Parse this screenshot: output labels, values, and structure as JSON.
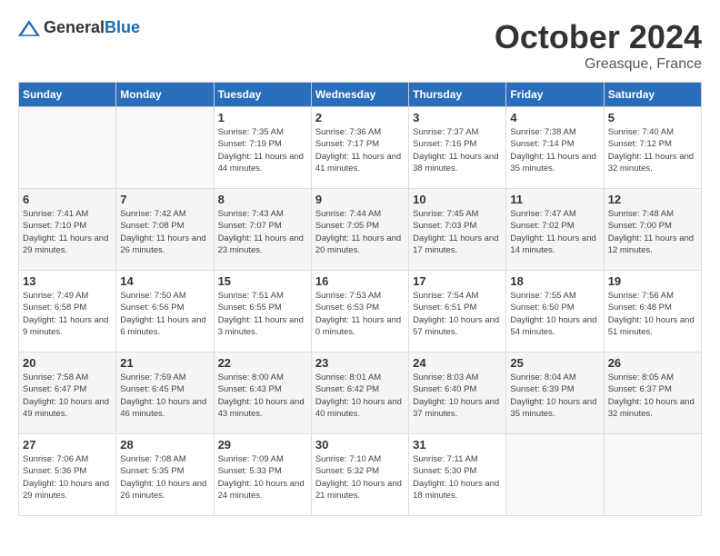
{
  "header": {
    "logo_general": "General",
    "logo_blue": "Blue",
    "month": "October 2024",
    "location": "Greasque, France"
  },
  "weekdays": [
    "Sunday",
    "Monday",
    "Tuesday",
    "Wednesday",
    "Thursday",
    "Friday",
    "Saturday"
  ],
  "weeks": [
    [
      {
        "day": "",
        "info": ""
      },
      {
        "day": "",
        "info": ""
      },
      {
        "day": "1",
        "info": "Sunrise: 7:35 AM\nSunset: 7:19 PM\nDaylight: 11 hours and 44 minutes."
      },
      {
        "day": "2",
        "info": "Sunrise: 7:36 AM\nSunset: 7:17 PM\nDaylight: 11 hours and 41 minutes."
      },
      {
        "day": "3",
        "info": "Sunrise: 7:37 AM\nSunset: 7:16 PM\nDaylight: 11 hours and 38 minutes."
      },
      {
        "day": "4",
        "info": "Sunrise: 7:38 AM\nSunset: 7:14 PM\nDaylight: 11 hours and 35 minutes."
      },
      {
        "day": "5",
        "info": "Sunrise: 7:40 AM\nSunset: 7:12 PM\nDaylight: 11 hours and 32 minutes."
      }
    ],
    [
      {
        "day": "6",
        "info": "Sunrise: 7:41 AM\nSunset: 7:10 PM\nDaylight: 11 hours and 29 minutes."
      },
      {
        "day": "7",
        "info": "Sunrise: 7:42 AM\nSunset: 7:08 PM\nDaylight: 11 hours and 26 minutes."
      },
      {
        "day": "8",
        "info": "Sunrise: 7:43 AM\nSunset: 7:07 PM\nDaylight: 11 hours and 23 minutes."
      },
      {
        "day": "9",
        "info": "Sunrise: 7:44 AM\nSunset: 7:05 PM\nDaylight: 11 hours and 20 minutes."
      },
      {
        "day": "10",
        "info": "Sunrise: 7:45 AM\nSunset: 7:03 PM\nDaylight: 11 hours and 17 minutes."
      },
      {
        "day": "11",
        "info": "Sunrise: 7:47 AM\nSunset: 7:02 PM\nDaylight: 11 hours and 14 minutes."
      },
      {
        "day": "12",
        "info": "Sunrise: 7:48 AM\nSunset: 7:00 PM\nDaylight: 11 hours and 12 minutes."
      }
    ],
    [
      {
        "day": "13",
        "info": "Sunrise: 7:49 AM\nSunset: 6:58 PM\nDaylight: 11 hours and 9 minutes."
      },
      {
        "day": "14",
        "info": "Sunrise: 7:50 AM\nSunset: 6:56 PM\nDaylight: 11 hours and 6 minutes."
      },
      {
        "day": "15",
        "info": "Sunrise: 7:51 AM\nSunset: 6:55 PM\nDaylight: 11 hours and 3 minutes."
      },
      {
        "day": "16",
        "info": "Sunrise: 7:53 AM\nSunset: 6:53 PM\nDaylight: 11 hours and 0 minutes."
      },
      {
        "day": "17",
        "info": "Sunrise: 7:54 AM\nSunset: 6:51 PM\nDaylight: 10 hours and 57 minutes."
      },
      {
        "day": "18",
        "info": "Sunrise: 7:55 AM\nSunset: 6:50 PM\nDaylight: 10 hours and 54 minutes."
      },
      {
        "day": "19",
        "info": "Sunrise: 7:56 AM\nSunset: 6:48 PM\nDaylight: 10 hours and 51 minutes."
      }
    ],
    [
      {
        "day": "20",
        "info": "Sunrise: 7:58 AM\nSunset: 6:47 PM\nDaylight: 10 hours and 49 minutes."
      },
      {
        "day": "21",
        "info": "Sunrise: 7:59 AM\nSunset: 6:45 PM\nDaylight: 10 hours and 46 minutes."
      },
      {
        "day": "22",
        "info": "Sunrise: 8:00 AM\nSunset: 6:43 PM\nDaylight: 10 hours and 43 minutes."
      },
      {
        "day": "23",
        "info": "Sunrise: 8:01 AM\nSunset: 6:42 PM\nDaylight: 10 hours and 40 minutes."
      },
      {
        "day": "24",
        "info": "Sunrise: 8:03 AM\nSunset: 6:40 PM\nDaylight: 10 hours and 37 minutes."
      },
      {
        "day": "25",
        "info": "Sunrise: 8:04 AM\nSunset: 6:39 PM\nDaylight: 10 hours and 35 minutes."
      },
      {
        "day": "26",
        "info": "Sunrise: 8:05 AM\nSunset: 6:37 PM\nDaylight: 10 hours and 32 minutes."
      }
    ],
    [
      {
        "day": "27",
        "info": "Sunrise: 7:06 AM\nSunset: 5:36 PM\nDaylight: 10 hours and 29 minutes."
      },
      {
        "day": "28",
        "info": "Sunrise: 7:08 AM\nSunset: 5:35 PM\nDaylight: 10 hours and 26 minutes."
      },
      {
        "day": "29",
        "info": "Sunrise: 7:09 AM\nSunset: 5:33 PM\nDaylight: 10 hours and 24 minutes."
      },
      {
        "day": "30",
        "info": "Sunrise: 7:10 AM\nSunset: 5:32 PM\nDaylight: 10 hours and 21 minutes."
      },
      {
        "day": "31",
        "info": "Sunrise: 7:11 AM\nSunset: 5:30 PM\nDaylight: 10 hours and 18 minutes."
      },
      {
        "day": "",
        "info": ""
      },
      {
        "day": "",
        "info": ""
      }
    ]
  ]
}
